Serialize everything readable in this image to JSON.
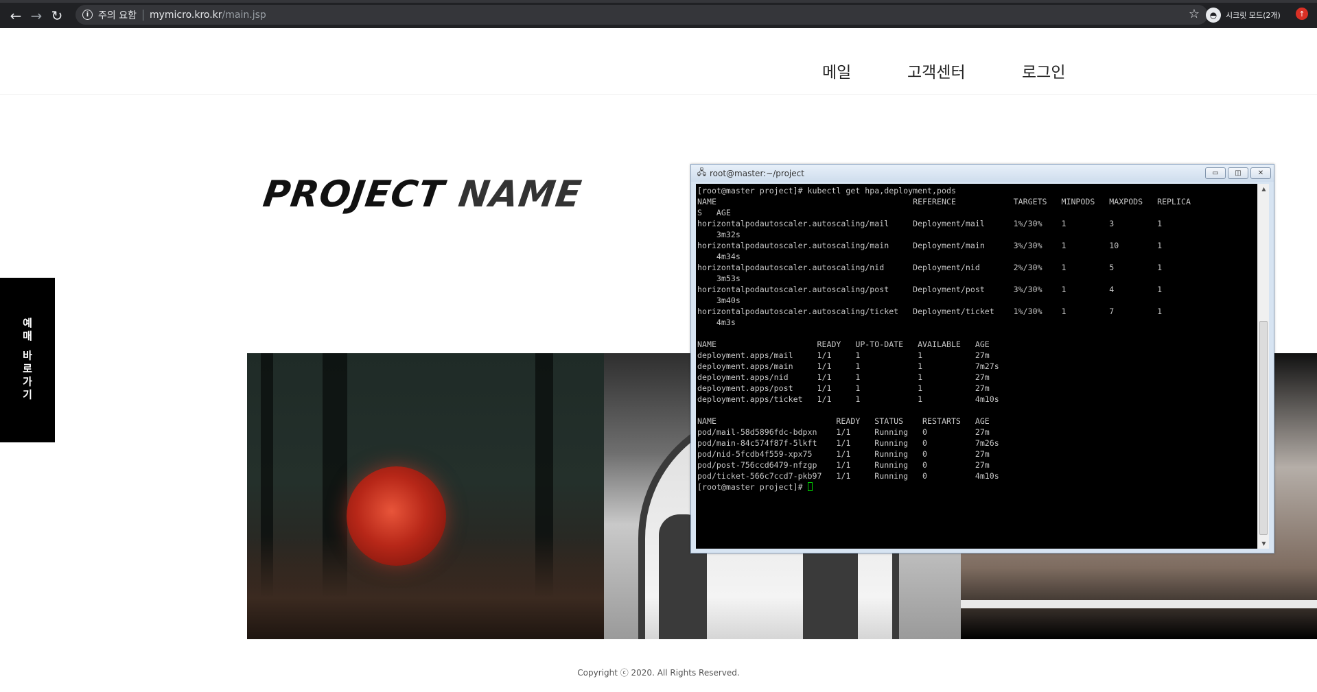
{
  "browser": {
    "security_warning": "주의 요함",
    "url_host": "mymicro.kro.kr",
    "url_path": "/main.jsp",
    "incognito_label": "시크릿 모드(2개)"
  },
  "header": {
    "nav": [
      {
        "label": "메일"
      },
      {
        "label": "고객센터"
      },
      {
        "label": "로그인"
      }
    ]
  },
  "logo": {
    "word1": "PROJECT",
    "word2": "NAME"
  },
  "side_tab": {
    "label": "예매 바로가기"
  },
  "footer": {
    "copyright": "Copyright ⓒ 2020. All Rights Reserved."
  },
  "terminal": {
    "title": "root@master:~/project",
    "output": "[root@master project]# kubectl get hpa,deployment,pods\nNAME                                         REFERENCE            TARGETS   MINPODS   MAXPODS   REPLICA\nS   AGE\nhorizontalpodautoscaler.autoscaling/mail     Deployment/mail      1%/30%    1         3         1\n    3m32s\nhorizontalpodautoscaler.autoscaling/main     Deployment/main      3%/30%    1         10        1\n    4m34s\nhorizontalpodautoscaler.autoscaling/nid      Deployment/nid       2%/30%    1         5         1\n    3m53s\nhorizontalpodautoscaler.autoscaling/post     Deployment/post      3%/30%    1         4         1\n    3m40s\nhorizontalpodautoscaler.autoscaling/ticket   Deployment/ticket    1%/30%    1         7         1\n    4m3s\n\nNAME                     READY   UP-TO-DATE   AVAILABLE   AGE\ndeployment.apps/mail     1/1     1            1           27m\ndeployment.apps/main     1/1     1            1           7m27s\ndeployment.apps/nid      1/1     1            1           27m\ndeployment.apps/post     1/1     1            1           27m\ndeployment.apps/ticket   1/1     1            1           4m10s\n\nNAME                         READY   STATUS    RESTARTS   AGE\npod/mail-58d5896fdc-bdpxn    1/1     Running   0          27m\npod/main-84c574f87f-5lkft    1/1     Running   0          7m26s\npod/nid-5fcdb4f559-xpx75     1/1     Running   0          27m\npod/post-756ccd6479-nfzgp    1/1     Running   0          27m\npod/ticket-566c7ccd7-pkb97   1/1     Running   0          4m10s\n",
    "prompt": "[root@master project]# "
  }
}
